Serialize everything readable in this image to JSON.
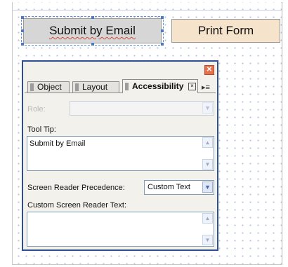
{
  "form": {
    "email_button_label": "Submit by Email",
    "print_button_label": "Print Form"
  },
  "panel": {
    "close_glyph": "✕",
    "tabs": [
      {
        "label": "Object"
      },
      {
        "label": "Layout"
      },
      {
        "label": "Accessibility"
      }
    ],
    "tab_close_glyph": "×",
    "tab_menu_glyph": "▸≡",
    "role": {
      "label": "Role:",
      "value": "",
      "enabled": false
    },
    "tooltip": {
      "label": "Tool Tip:",
      "value": "Submit by Email"
    },
    "precedence": {
      "label": "Screen Reader Precedence:",
      "value": "Custom Text"
    },
    "custom_text": {
      "label": "Custom Screen Reader Text:",
      "value": ""
    }
  },
  "colors": {
    "panel_border": "#2f4f95",
    "email_button_bg": "#d6d6d6",
    "print_button_bg": "#f6e3cb",
    "close_button": "#e8704a"
  }
}
